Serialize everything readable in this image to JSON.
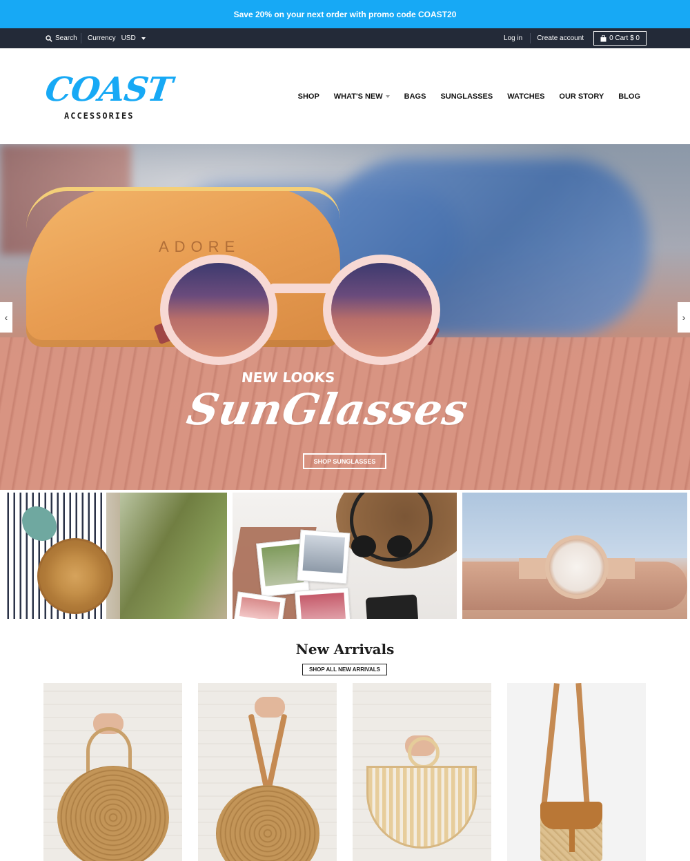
{
  "announcement": {
    "text": "Save 20% on your next order with promo code COAST20"
  },
  "utility": {
    "search_label": "Search",
    "currency_label": "Currency",
    "currency_value": "USD",
    "login_label": "Log in",
    "create_account_label": "Create account",
    "cart_label": "0 Cart $ 0"
  },
  "header": {
    "logo_main": "COAST",
    "logo_sub": "ACCESSORIES",
    "nav": [
      "SHOP",
      "WHAT'S NEW",
      "BAGS",
      "SUNGLASSES",
      "WATCHES",
      "OUR STORY",
      "BLOG"
    ]
  },
  "hero": {
    "case_text": "ADORE",
    "tagline": "NEW LOOKS",
    "headline": "SunGlasses",
    "cta_label": "SHOP SUNGLASSES",
    "prev_arrow": "‹",
    "next_arrow": "›"
  },
  "new_arrivals": {
    "title": "New Arrivals",
    "button_label": "SHOP ALL NEW ARRIVALS"
  },
  "colors": {
    "accent": "#17a9f5",
    "utility_bar": "#232a38"
  },
  "icons": {
    "search": "search-icon",
    "cart": "bag-icon",
    "dropdown": "chevron-down-icon",
    "prev": "chevron-left-icon",
    "next": "chevron-right-icon"
  }
}
